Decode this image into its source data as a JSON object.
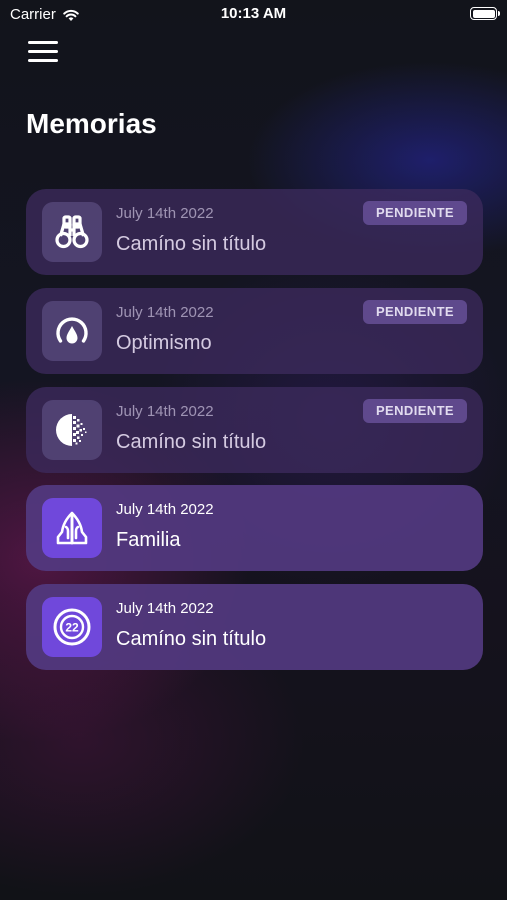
{
  "status_bar": {
    "carrier": "Carrier",
    "time": "10:13 AM"
  },
  "header": {
    "title": "Memorias",
    "menu_icon": "hamburger-menu-icon"
  },
  "memories": [
    {
      "date": "July 14th 2022",
      "title": "Camíno sin título",
      "badge": "PENDIENTE",
      "icon": "binoculars-icon"
    },
    {
      "date": "July 14th 2022",
      "title": "Optimismo",
      "badge": "PENDIENTE",
      "icon": "drop-circle-icon"
    },
    {
      "date": "July 14th 2022",
      "title": "Camíno sin título",
      "badge": "PENDIENTE",
      "icon": "dissolving-moon-icon"
    },
    {
      "date": "July 14th 2022",
      "title": "Familia",
      "icon": "praying-hands-icon"
    },
    {
      "date": "July 14th 2022",
      "title": "Camíno sin título",
      "icon": "target-22-icon",
      "icon_text": "22"
    }
  ],
  "colors": {
    "card_pending": "#3c2a5c",
    "card_done": "#523a80",
    "icon_done": "#7048db",
    "badge_bg": "#6e55a0"
  }
}
